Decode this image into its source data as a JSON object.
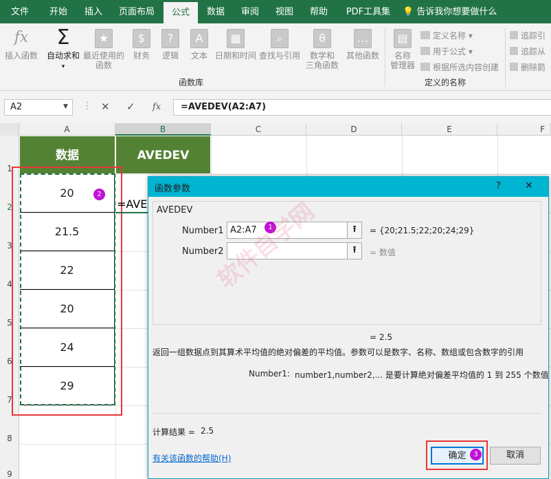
{
  "ribbon": {
    "tabs": [
      "文件",
      "开始",
      "插入",
      "页面布局",
      "公式",
      "数据",
      "审阅",
      "视图",
      "帮助",
      "PDF工具集"
    ],
    "active_tab": "公式",
    "tell_me": "告诉我你想要做什么",
    "buttons": {
      "insert_function": "插入函数",
      "autosum": "自动求和",
      "recent_1": "最近使用的",
      "recent_2": "函数",
      "financial": "财务",
      "logical": "逻辑",
      "text": "文本",
      "datetime": "日期和时间",
      "lookup": "查找与引用",
      "math_1": "数学和",
      "math_2": "三角函数",
      "more": "其他函数",
      "name_mgr_1": "名称",
      "name_mgr_2": "管理器",
      "define_name": "定义名称",
      "use_in_formula": "用于公式",
      "create_from_sel": "根据所选内容创建",
      "trace_precedents": "追踪引",
      "trace_dependents": "追踪从",
      "remove_arrows": "删除箭"
    },
    "groups": {
      "function_library": "函数库",
      "defined_names": "定义的名称"
    }
  },
  "formula_bar": {
    "name_box": "A2",
    "cancel_icon": "✕",
    "enter_icon": "✓",
    "fx_icon": "fx",
    "formula": "=AVEDEV(A2:A7)"
  },
  "sheet": {
    "columns": [
      "A",
      "B",
      "C",
      "D",
      "E",
      "F"
    ],
    "rows": [
      "1",
      "2",
      "3",
      "4",
      "5",
      "6",
      "7",
      "8",
      "9"
    ],
    "header_a": "数据",
    "header_b": "AVEDEV",
    "values": [
      "20",
      "21.5",
      "22",
      "20",
      "24",
      "29"
    ],
    "b2_partial": "=AVE",
    "header_fill": "#548235",
    "accent": "#217346"
  },
  "annotations": {
    "badge1": "1",
    "badge2": "2",
    "badge3": "3",
    "badge_color": "#c011d8",
    "highlight_color": "#e8363a"
  },
  "dialog": {
    "title": "函数参数",
    "help_q": "?",
    "close": "✕",
    "function_name": "AVEDEV",
    "arg1_label": "Number1",
    "arg1_value": "A2:A7",
    "arg1_eval": "=  {20;21.5;22;20;24;29}",
    "arg2_label": "Number2",
    "arg2_value": "",
    "arg2_eval": "=  数值",
    "result_eq": "=  2.5",
    "description": "返回一组数据点到其算术平均值的绝对偏差的平均值。参数可以是数字、名称、数组或包含数字的引用",
    "arg_help_label": "Number1:",
    "arg_help_text": "number1,number2,... 是要计算绝对偏差平均值的 1 到 255 个数值",
    "calc_result_label": "计算结果 =",
    "calc_result_value": "2.5",
    "help_link": "有关该函数的帮助(H)",
    "ok": "确定",
    "cancel": "取消",
    "title_color": "#00b4d2"
  }
}
